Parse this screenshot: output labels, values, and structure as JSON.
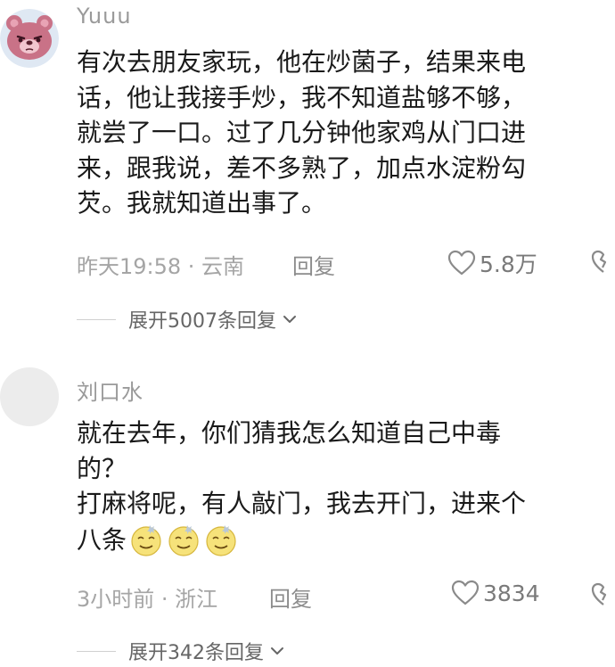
{
  "comments": [
    {
      "username": "Yuuu",
      "avatar": "strawberry-bear",
      "lines": [
        "有次去朋友家玩，他在炒菌子，结果来电",
        "话，他让我接手炒，我不知道盐够不够，",
        "就尝了一口。过了几分钟他家鸡从门口进",
        "来，跟我说，差不多熟了，加点水淀粉勾",
        "芡。我就知道出事了。"
      ],
      "meta": "昨天19:58 · 云南",
      "reply_label": "回复",
      "likes": "5.8万",
      "expand_label": "展开5007条回复"
    },
    {
      "username": "刘口水",
      "avatar": "blank-gray",
      "lines": [
        "就在去年，你们猜我怎么知道自己中毒",
        "的？",
        "打麻将呢，有人敲门，我去开门，进来个",
        "八条"
      ],
      "emoji": [
        "dizzy-face",
        "dizzy-face",
        "dizzy-face"
      ],
      "meta": "3小时前 · 浙江",
      "reply_label": "回复",
      "likes": "3834",
      "expand_label": "展开342条回复"
    }
  ],
  "colors": {
    "text": "#1a1a1a",
    "muted": "#a5a5a5",
    "avatar_pink": "#c97287",
    "avatar_bg": "#dfe8f3",
    "placeholder_avatar": "#ececec"
  }
}
